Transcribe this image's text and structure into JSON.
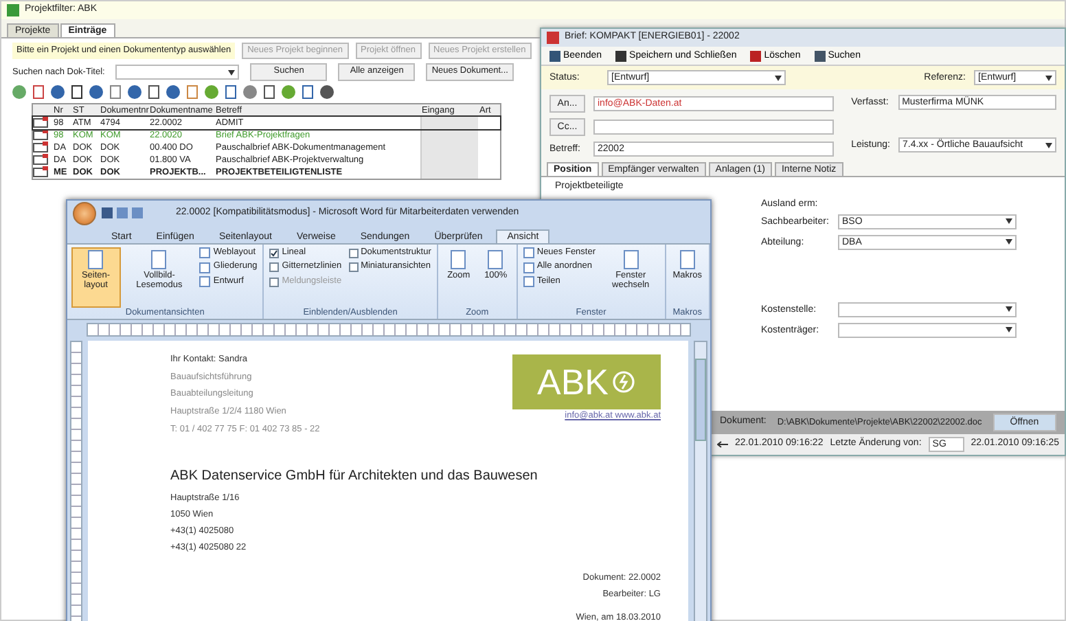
{
  "back_window": {
    "title": "Projektfilter: ABK",
    "tabs": [
      {
        "label": "Projekte",
        "selected": false
      },
      {
        "label": "Einträge",
        "selected": true
      }
    ],
    "hint": "Bitte ein Projekt und einen Dokumententyp auswählen",
    "top_buttons": [
      "Neues Projekt beginnen",
      "Projekt öffnen",
      "Neues Projekt erstellen"
    ],
    "search_label": "Suchen nach Dok-Titel:",
    "search_buttons": [
      "Suchen",
      "Alle anzeigen",
      "Neues Dokument..."
    ],
    "table": {
      "columns": [
        "Nr",
        "ST",
        "Dokumentnr",
        "Dokumentname",
        "Betreff",
        "Eingang",
        "Art"
      ],
      "rows": [
        {
          "cells": [
            "98",
            "ATM",
            "4794",
            "22.0002",
            "ADMIT"
          ],
          "selected": true,
          "bold": false,
          "color": "#222222"
        },
        {
          "cells": [
            "98",
            "KOM",
            "KOM",
            "22.0020",
            "Brief ABK-Projektfragen"
          ],
          "selected": false,
          "bold": false,
          "color": "#3f9a2a"
        },
        {
          "cells": [
            "DA",
            "DOK",
            "DOK",
            "00.400 DO",
            "Pauschalbrief ABK-Dokumentmanagement"
          ],
          "selected": false,
          "bold": false,
          "color": "#222222"
        },
        {
          "cells": [
            "DA",
            "DOK",
            "DOK",
            "01.800 VA",
            "Pauschalbrief ABK-Projektverwaltung"
          ],
          "selected": false,
          "bold": false,
          "color": "#222222"
        },
        {
          "cells": [
            "ME",
            "DOK",
            "DOK",
            "PROJEKTB...",
            "PROJEKTBETEILIGTENLISTE"
          ],
          "selected": false,
          "bold": true,
          "color": "#222222"
        }
      ]
    }
  },
  "letter_window": {
    "title": "Brief: KOMPAKT [ENERGIEB01] - 22002",
    "toolbar": [
      "Beenden",
      "Speichern und Schließen",
      "Löschen",
      "Suchen"
    ],
    "status": {
      "label": "Status:",
      "value": "[Entwurf]"
    },
    "reference": {
      "label": "Referenz:",
      "value": "[Entwurf]"
    },
    "to_button": "An...",
    "to_value": "info@ABK-Daten.at",
    "cc_button": "Cc...",
    "subject": {
      "label": "Betreff:",
      "value": "22002"
    },
    "author": {
      "label": "Verfasst:",
      "value": "Musterfirma MÜNK"
    },
    "service": {
      "label": "Leistung:",
      "value": "7.4.xx - Örtliche Bauaufsicht"
    },
    "tabs": [
      {
        "label": "Position",
        "selected": true
      },
      {
        "label": "Empfänger verwalten",
        "selected": false
      },
      {
        "label": "Anlagen (1)",
        "selected": false
      },
      {
        "label": "Interne Notiz",
        "selected": false
      }
    ],
    "section_label": "Projektbeteiligte",
    "fields": [
      {
        "label": "Ausland erm:",
        "kind": "label"
      },
      {
        "label": "Sachbearbeiter:",
        "kind": "select",
        "value": "BSO"
      },
      {
        "label": "Abteilung:",
        "kind": "select",
        "value": "DBA"
      },
      {
        "label": "Kostenstelle:",
        "kind": "select"
      },
      {
        "label": "Kostenträger:",
        "kind": "select"
      }
    ],
    "document_label": "Dokument:",
    "document_path": "D:\\ABK\\Dokumente\\Projekte\\ABK\\22002\\22002.doc",
    "open_button": "Öffnen",
    "created": "22.01.2010 09:16:22",
    "changed_label": "Letzte Änderung von:",
    "changed_by": "SG",
    "changed": "22.01.2010 09:16:25"
  },
  "word_window": {
    "title": "22.0002 [Kompatibilitätsmodus] - Microsoft Word für Mitarbeiterdaten verwenden",
    "tabs": [
      {
        "label": "Start",
        "selected": false
      },
      {
        "label": "Einfügen",
        "selected": false
      },
      {
        "label": "Seitenlayout",
        "selected": false
      },
      {
        "label": "Verweise",
        "selected": false
      },
      {
        "label": "Sendungen",
        "selected": false
      },
      {
        "label": "Überprüfen",
        "selected": false
      },
      {
        "label": "Ansicht",
        "selected": true
      }
    ],
    "groups": [
      {
        "kind": "views",
        "label": "Dokumentansichten",
        "big": [
          {
            "label": "Seiten-layout",
            "selected": true
          },
          {
            "label": "Vollbild-Lesemodus",
            "selected": false
          }
        ],
        "small": [
          "Weblayout",
          "Gliederung",
          "Entwurf"
        ]
      },
      {
        "kind": "checks",
        "label": "Einblenden/Ausblenden",
        "checks": [
          {
            "label": "Lineal",
            "checked": true,
            "disabled": false
          },
          {
            "label": "Gitternetzlinien",
            "checked": false,
            "disabled": false
          },
          {
            "label": "Meldungsleiste",
            "checked": false,
            "disabled": true
          },
          {
            "label": "Dokumentstruktur",
            "checked": false,
            "disabled": false
          },
          {
            "label": "Miniaturansichten",
            "checked": false,
            "disabled": false
          }
        ]
      },
      {
        "kind": "zoom",
        "label": "Zoom",
        "big": [
          {
            "label": "Zoom",
            "selected": false
          },
          {
            "label": "100%",
            "selected": false
          }
        ]
      },
      {
        "kind": "window",
        "label": "Fenster",
        "small": [
          "Neues Fenster",
          "Alle anordnen",
          "Teilen"
        ],
        "big": [
          {
            "label": "Fenster wechseln",
            "selected": false
          }
        ]
      },
      {
        "kind": "macros",
        "label": "Makros",
        "big": [
          {
            "label": "Makros",
            "selected": false
          }
        ]
      }
    ],
    "sender": {
      "contact": "Ihr Kontakt: Sandra",
      "lines": [
        "Bauaufsichtsführung",
        "Bauabteilungsleitung"
      ],
      "address": "Hauptstraße 1/2/4 1180 Wien",
      "phone": "T: 01 / 402 77 75 F: 01 402 73 85 - 22"
    },
    "logo": {
      "text": "ABK",
      "link": "info@abk.at www.abk.at"
    },
    "recipient": {
      "name": "ABK Datenservice GmbH für Architekten und das Bauwesen",
      "lines": [
        "Hauptstraße 1/16",
        "1050 Wien",
        "+43(1) 4025080",
        "+43(1) 4025080 22"
      ]
    },
    "meta": [
      "Dokument: 22.0002",
      "Bearbeiter: LG"
    ],
    "date": "Wien, am 18.03.2010"
  }
}
